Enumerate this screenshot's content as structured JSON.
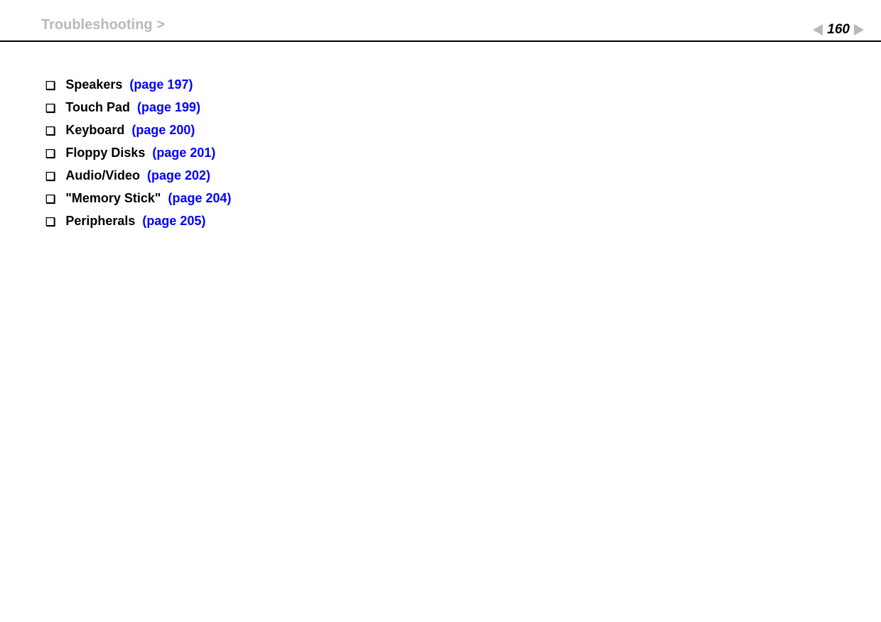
{
  "header": {
    "breadcrumb": "Troubleshooting >",
    "page_number": "160",
    "n_prefix": "n"
  },
  "items": [
    {
      "label": "Speakers",
      "page_link": "(page 197)"
    },
    {
      "label": "Touch Pad",
      "page_link": "(page 199)"
    },
    {
      "label": "Keyboard",
      "page_link": "(page 200)"
    },
    {
      "label": "Floppy Disks",
      "page_link": "(page 201)"
    },
    {
      "label": "Audio/Video",
      "page_link": "(page 202)"
    },
    {
      "label": "\"Memory Stick\"",
      "page_link": "(page 204)"
    },
    {
      "label": "Peripherals",
      "page_link": "(page 205)"
    }
  ]
}
